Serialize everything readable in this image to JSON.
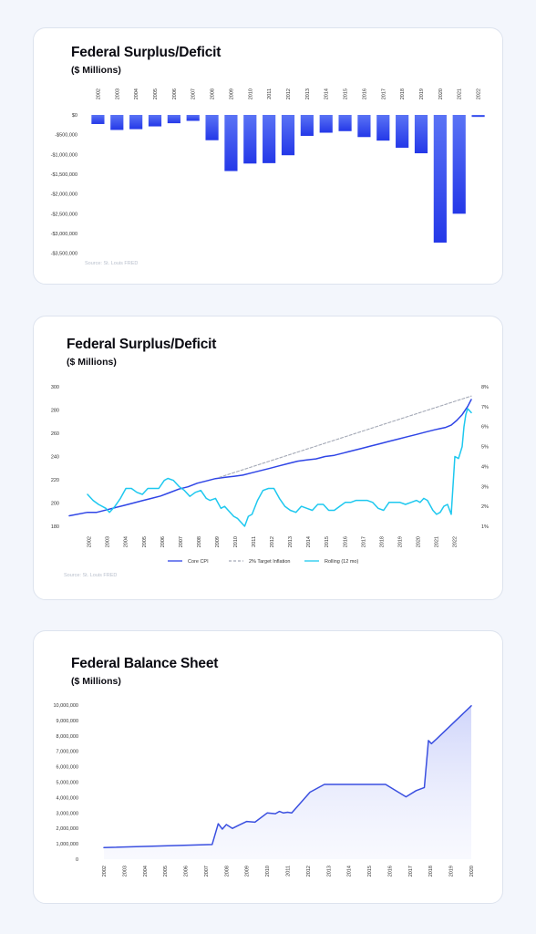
{
  "chart_data": [
    {
      "type": "bar",
      "title": "Federal Surplus/Deficit",
      "subtitle": "($ Millions)",
      "source": "Source: St. Louis FRED",
      "categories": [
        "2002",
        "2003",
        "2004",
        "2005",
        "2006",
        "2007",
        "2008",
        "2009",
        "2010",
        "2011",
        "2012",
        "2013",
        "2014",
        "2015",
        "2016",
        "2017",
        "2018",
        "2019",
        "2020",
        "2021",
        "2022"
      ],
      "values": [
        -230000,
        -380000,
        -360000,
        -290000,
        -210000,
        -150000,
        -640000,
        -1420000,
        -1230000,
        -1220000,
        -1020000,
        -530000,
        -450000,
        -410000,
        -560000,
        -650000,
        -830000,
        -970000,
        -3230000,
        -2500000,
        -50000
      ],
      "yticks": [
        0,
        -500000,
        -1000000,
        -1500000,
        -2000000,
        -2500000,
        -3000000,
        -3500000
      ],
      "ytick_labels": [
        "$0",
        "-$500,000",
        "-$1,000,000",
        "-$1,500,000",
        "-$2,000,000",
        "-$2,500,000",
        "-$3,000,000",
        "-$3,500,000"
      ],
      "ylim": [
        -3600000,
        0
      ],
      "colors": {
        "bar_top": "#5a73f5",
        "bar_bottom": "#2438e8"
      }
    },
    {
      "type": "line",
      "title": "Federal Surplus/Deficit",
      "subtitle": "($ Millions)",
      "source": "Source: St. Louis FRED",
      "x_labels": [
        "2002",
        "2003",
        "2004",
        "2005",
        "2006",
        "2007",
        "2008",
        "2009",
        "2010",
        "2011",
        "2012",
        "2013",
        "2014",
        "2015",
        "2016",
        "2017",
        "2018",
        "2019",
        "2020",
        "2021",
        "2022"
      ],
      "xlim": [
        2001.0,
        2023.0
      ],
      "ylim_left": [
        180,
        300
      ],
      "yticks_left": [
        180,
        200,
        220,
        240,
        260,
        280,
        300
      ],
      "ylim_right": [
        1,
        8
      ],
      "yticks_right": [
        1,
        2,
        3,
        4,
        5,
        6,
        7,
        8
      ],
      "ytick_labels_right": [
        "1%",
        "2%",
        "3%",
        "4%",
        "5%",
        "6%",
        "7%",
        "8%"
      ],
      "series": [
        {
          "name": "Core CPI",
          "axis": "left",
          "color": "#2f45e6",
          "dash": false,
          "x": [
            2001.0,
            2002.0,
            2002.5,
            2003.0,
            2003.5,
            2004.0,
            2004.5,
            2005.0,
            2005.5,
            2006.0,
            2006.5,
            2007.0,
            2007.5,
            2008.0,
            2008.5,
            2009.0,
            2009.5,
            2010.0,
            2010.5,
            2011.0,
            2011.5,
            2012.0,
            2012.5,
            2013.0,
            2013.5,
            2014.0,
            2014.5,
            2015.0,
            2015.5,
            2016.0,
            2016.5,
            2017.0,
            2017.5,
            2018.0,
            2018.5,
            2019.0,
            2019.5,
            2020.0,
            2020.5,
            2021.0,
            2021.3,
            2021.6,
            2021.9,
            2022.2,
            2022.5,
            2022.8,
            2023.0
          ],
          "y": [
            189,
            192,
            192,
            194,
            196,
            198,
            200,
            202,
            204,
            206,
            209,
            212,
            214,
            217,
            219,
            221,
            222,
            223,
            224,
            226,
            228,
            230,
            232,
            234,
            236,
            237,
            238,
            240,
            241,
            243,
            245,
            247,
            249,
            251,
            253,
            255,
            257,
            259,
            261,
            263,
            264,
            265,
            267,
            271,
            276,
            283,
            289
          ]
        },
        {
          "name": "2% Target Inflation",
          "axis": "left",
          "color": "#a4a9b6",
          "dash": true,
          "x": [
            2009.2,
            2023.0
          ],
          "y": [
            222,
            292
          ]
        },
        {
          "name": "Rolling (12 mo)",
          "axis": "right",
          "color": "#1ec8ef",
          "dash": false,
          "x": [
            2002.0,
            2002.3,
            2002.6,
            2003.0,
            2003.2,
            2003.5,
            2003.8,
            2004.1,
            2004.4,
            2004.7,
            2005.0,
            2005.3,
            2005.6,
            2005.9,
            2006.2,
            2006.4,
            2006.7,
            2007.0,
            2007.3,
            2007.6,
            2007.9,
            2008.2,
            2008.5,
            2008.7,
            2009.0,
            2009.3,
            2009.5,
            2009.8,
            2010.0,
            2010.2,
            2010.4,
            2010.6,
            2010.8,
            2011.0,
            2011.3,
            2011.6,
            2011.9,
            2012.2,
            2012.5,
            2012.8,
            2013.1,
            2013.4,
            2013.7,
            2014.0,
            2014.3,
            2014.6,
            2014.9,
            2015.2,
            2015.5,
            2015.8,
            2016.1,
            2016.4,
            2016.7,
            2017.0,
            2017.3,
            2017.6,
            2017.9,
            2018.2,
            2018.5,
            2018.8,
            2019.1,
            2019.4,
            2019.7,
            2020.0,
            2020.2,
            2020.4,
            2020.6,
            2020.9,
            2021.1,
            2021.3,
            2021.5,
            2021.7,
            2021.9,
            2022.1,
            2022.3,
            2022.5,
            2022.6,
            2022.7,
            2022.8,
            2023.0
          ],
          "y": [
            2.6,
            2.3,
            2.1,
            1.9,
            1.7,
            2.0,
            2.4,
            2.9,
            2.9,
            2.7,
            2.6,
            2.9,
            2.9,
            2.9,
            3.3,
            3.4,
            3.3,
            3.0,
            2.8,
            2.5,
            2.7,
            2.8,
            2.4,
            2.3,
            2.4,
            1.9,
            2.0,
            1.7,
            1.5,
            1.4,
            1.2,
            1.0,
            1.5,
            1.6,
            2.3,
            2.8,
            2.9,
            2.9,
            2.4,
            2.0,
            1.8,
            1.7,
            2.0,
            1.9,
            1.8,
            2.1,
            2.1,
            1.8,
            1.8,
            2.0,
            2.2,
            2.2,
            2.3,
            2.3,
            2.3,
            2.2,
            1.9,
            1.8,
            2.2,
            2.2,
            2.2,
            2.1,
            2.2,
            2.3,
            2.2,
            2.4,
            2.3,
            1.8,
            1.6,
            1.7,
            2.0,
            2.1,
            1.6,
            4.5,
            4.4,
            5.0,
            6.0,
            6.6,
            6.9,
            6.7
          ]
        }
      ],
      "legend": "bottom"
    },
    {
      "type": "area",
      "title": "Federal Balance Sheet",
      "subtitle": "($ Millions)",
      "x_labels": [
        "2002",
        "2003",
        "2004",
        "2005",
        "2006",
        "2007",
        "2008",
        "2009",
        "2010",
        "2011",
        "2012",
        "2013",
        "2014",
        "2015",
        "2016",
        "2017",
        "2018",
        "2019",
        "2020"
      ],
      "xlim": [
        2002.0,
        2020.0
      ],
      "ylim": [
        0,
        10000000
      ],
      "yticks": [
        0,
        1000000,
        2000000,
        3000000,
        4000000,
        5000000,
        6000000,
        7000000,
        8000000,
        9000000,
        10000000
      ],
      "ytick_labels": [
        "0",
        "1,000,000",
        "2,000,000",
        "3,000,000",
        "4,000,000",
        "5,000,000",
        "6,000,000",
        "7,000,000",
        "8,000,000",
        "9,000,000",
        "10,000,000"
      ],
      "series": [
        {
          "name": "",
          "color": "#3a4fe0",
          "x": [
            2002.0,
            2007.3,
            2007.6,
            2007.8,
            2008.0,
            2008.3,
            2008.6,
            2009.0,
            2009.4,
            2010.0,
            2010.4,
            2010.6,
            2010.8,
            2011.0,
            2011.2,
            2012.1,
            2012.8,
            2015.8,
            2016.8,
            2017.3,
            2017.7,
            2017.9,
            2018.05,
            2018.3,
            2020.0
          ],
          "y": [
            750000,
            950000,
            2300000,
            1950000,
            2250000,
            2000000,
            2200000,
            2450000,
            2400000,
            3000000,
            2950000,
            3100000,
            3000000,
            3050000,
            3000000,
            4350000,
            4850000,
            4850000,
            4050000,
            4450000,
            4650000,
            7700000,
            7500000,
            7800000,
            9950000
          ]
        }
      ]
    }
  ]
}
